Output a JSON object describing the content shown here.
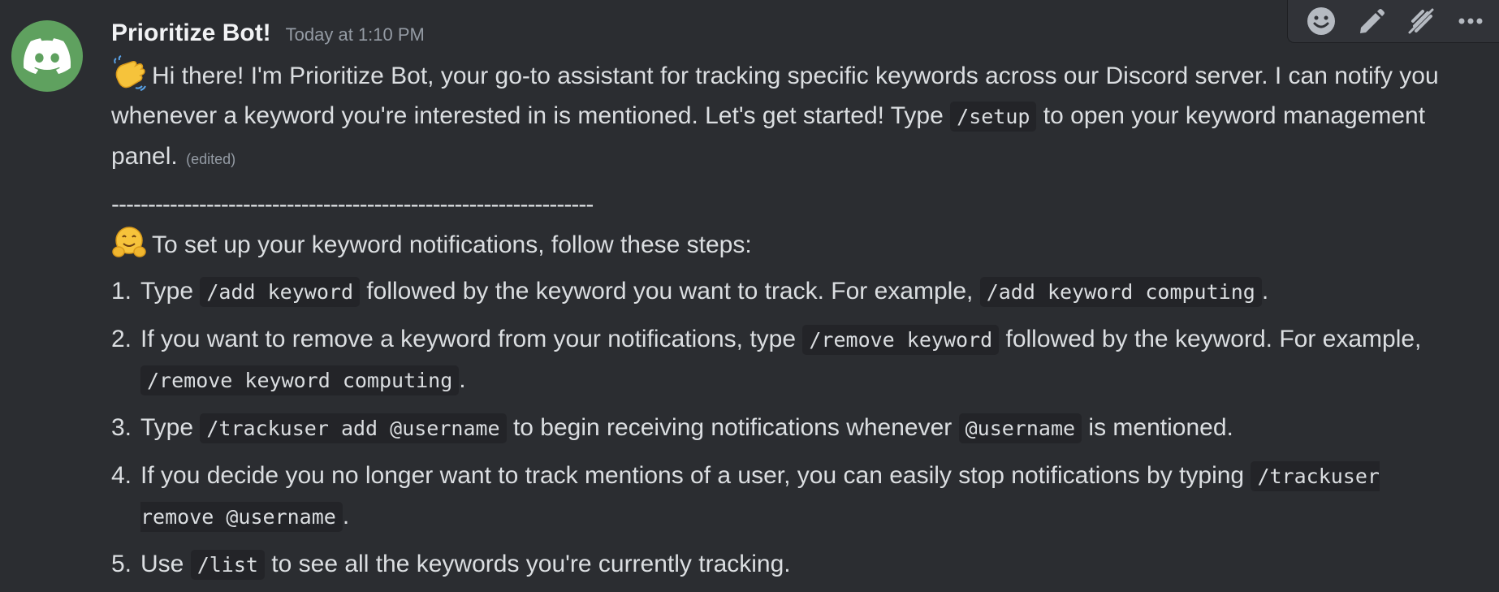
{
  "message": {
    "author": "Prioritize Bot!",
    "timestamp": "Today at 1:10 PM",
    "intro": {
      "emoji": "waving-hand",
      "text1": "Hi there! I'm Prioritize Bot, your go-to assistant for tracking specific keywords across our Discord server. I can notify you whenever a keyword you're interested in is mentioned. Let's get started! Type ",
      "code1": "/setup",
      "text2": " to open your keyword management panel.",
      "edited": "(edited)"
    },
    "divider": "------------------------------------------------------------------",
    "steps_intro": {
      "emoji": "hugging-face",
      "text": "To set up your keyword notifications, follow these steps:"
    },
    "steps": [
      {
        "num": "1.",
        "t1": "Type ",
        "c1": "/add keyword",
        "t2": " followed by the keyword you want to track. For example, ",
        "c2": "/add keyword computing",
        "t3": "."
      },
      {
        "num": "2.",
        "t1": "If you want to remove a keyword from your notifications, type ",
        "c1": "/remove keyword",
        "t2": " followed by the keyword. For example, ",
        "c2": "/remove keyword computing",
        "t3": "."
      },
      {
        "num": "3.",
        "t1": "Type ",
        "c1": "/trackuser add @username",
        "t2": " to begin receiving notifications whenever ",
        "c2": "@username",
        "t3": " is mentioned."
      },
      {
        "num": "4.",
        "t1": "If you decide you no longer want to track mentions of a user, you can easily stop notifications by typing ",
        "c1": "/trackuser remove @username",
        "t2": ".",
        "c2": "",
        "t3": ""
      },
      {
        "num": "5.",
        "t1": "Use ",
        "c1": "/list",
        "t2": " to see all the keywords you're currently tracking.",
        "c2": "",
        "t3": ""
      }
    ]
  },
  "toolbar": {
    "buttons": [
      "add-reaction-icon",
      "edit-icon",
      "clear-components-icon",
      "more-icon"
    ]
  },
  "colors": {
    "background": "#2b2d31",
    "avatar": "#5fa15f",
    "code_bg": "#232428",
    "muted": "#949ba4"
  }
}
